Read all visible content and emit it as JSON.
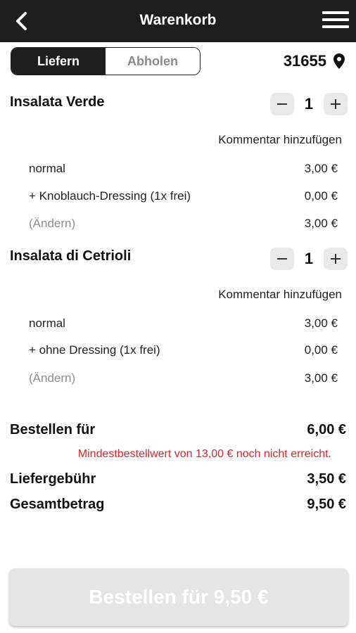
{
  "header": {
    "title": "Warenkorb",
    "back_icon": "chevron-left-icon",
    "menu_icon": "hamburger-menu-icon"
  },
  "mode_toggle": {
    "options": [
      "Liefern",
      "Abholen"
    ],
    "selected": "Liefern"
  },
  "location": {
    "zip": "31655",
    "icon": "map-pin-icon"
  },
  "items": [
    {
      "name": "Insalata Verde",
      "quantity": "1",
      "comment_label": "Kommentar hinzufügen",
      "lines": [
        {
          "label": "normal",
          "price": "3,00 €"
        },
        {
          "label": "+ Knoblauch-Dressing (1x frei)",
          "price": "0,00 €"
        },
        {
          "label": "(Ändern)",
          "price": "3,00 €"
        }
      ]
    },
    {
      "name": "Insalata di Cetrioli",
      "quantity": "1",
      "comment_label": "Kommentar hinzufügen",
      "lines": [
        {
          "label": "normal",
          "price": "3,00 €"
        },
        {
          "label": "+ ohne Dressing (1x frei)",
          "price": "0,00 €"
        },
        {
          "label": "(Ändern)",
          "price": "3,00 €"
        }
      ]
    }
  ],
  "summary": {
    "order_for_label": "Bestellen für",
    "order_for_value": "6,00 €",
    "min_order_warning": "Mindestbestellwert von 13,00 € noch nicht erreicht.",
    "delivery_fee_label": "Liefergebühr",
    "delivery_fee_value": "3,50 €",
    "total_label": "Gesamtbetrag",
    "total_value": "9,50 €"
  },
  "order_button": {
    "label": "Bestellen für 9,50 €"
  },
  "colors": {
    "header_bg": "#1e1e1e",
    "warning": "#d9262c",
    "button_disabled_bg": "#e5e5e5"
  }
}
